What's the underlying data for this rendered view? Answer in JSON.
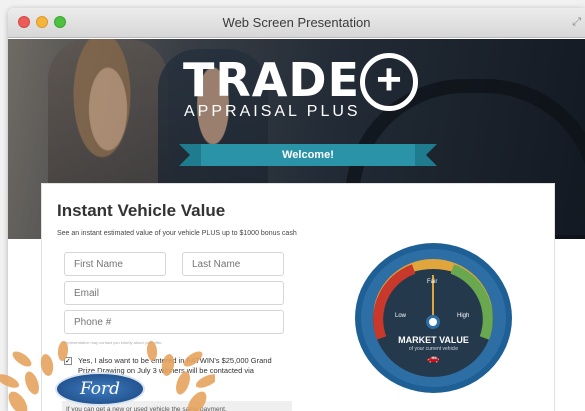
{
  "window": {
    "title": "Web Screen Presentation"
  },
  "hero": {
    "brand": "TRADE",
    "brand_plus": "+",
    "brand_sub": "APPRAISAL PLUS",
    "welcome": "Welcome!"
  },
  "form": {
    "title": "Instant Vehicle Value",
    "subtitle": "See an instant estimated value of your vehicle PLUS up to $1000 bonus cash",
    "first_name_placeholder": "First Name",
    "last_name_placeholder": "Last Name",
    "email_placeholder": "Email",
    "phone_placeholder": "Phone #",
    "disclaimer": "representative may contact you shortly about your offer.",
    "checkbox_text": "Yes, I also want to be entered in FATWIN's $25,000 Grand Prize Drawing on July 3 winners will be contacted via",
    "bottom_note": "If you can get a new or used vehicle the same payment."
  },
  "gauge": {
    "fair": "Fair",
    "low": "Low",
    "high": "High",
    "label": "MARKET VALUE",
    "sublabel": "of your current vehicle",
    "needle_value": "Fair"
  },
  "badge": {
    "text": "Ford"
  },
  "colors": {
    "ribbon": "#2a93a8",
    "gauge_ring": "#2d6fa4",
    "needle": "#e0a63b"
  }
}
